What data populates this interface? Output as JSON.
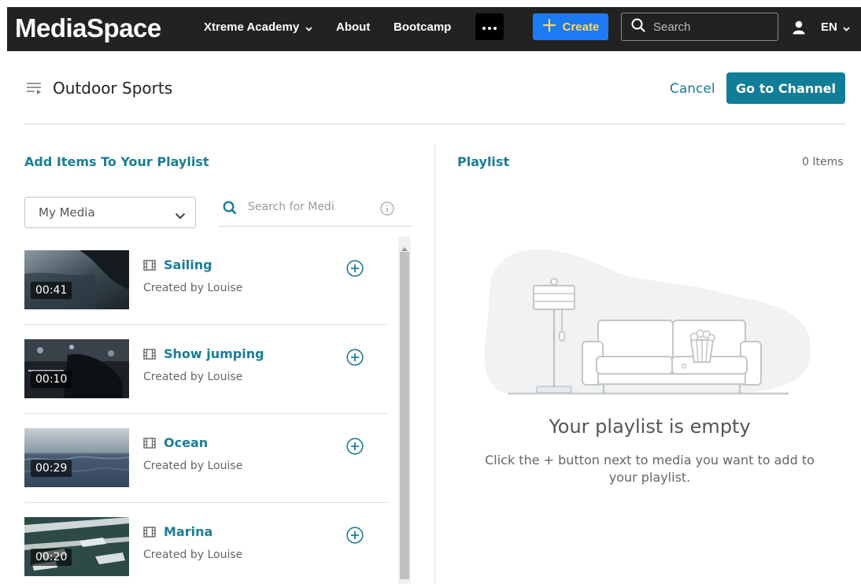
{
  "navbar": {
    "logo": "MediaSpace",
    "academy_label": "Xtreme Academy",
    "about_label": "About",
    "bootcamp_label": "Bootcamp",
    "create_label": "Create",
    "search_placeholder": "Search",
    "lang_label": "EN"
  },
  "header": {
    "title": "Outdoor Sports",
    "cancel_label": "Cancel",
    "goto_label": "Go to Channel"
  },
  "left_panel": {
    "title": "Add Items To Your Playlist",
    "source_select_value": "My Media",
    "search_placeholder": "Search for Medi",
    "items": [
      {
        "name": "Sailing",
        "creator": "Created by Louise",
        "duration": "00:41"
      },
      {
        "name": "Show jumping",
        "creator": "Created by Louise",
        "duration": "00:10"
      },
      {
        "name": "Ocean",
        "creator": "Created by Louise",
        "duration": "00:29"
      },
      {
        "name": "Marina",
        "creator": "Created by Louise",
        "duration": "00:20"
      }
    ]
  },
  "right_panel": {
    "title": "Playlist",
    "item_count": "0 Items",
    "empty_title": "Your playlist is empty",
    "empty_description": "Click the + button next to media you want to add to your playlist."
  },
  "colors": {
    "accent": "#1b7d97",
    "navbar_bg": "#222222",
    "create_bg": "#1d7af3",
    "create_text": "#fbd75b"
  }
}
